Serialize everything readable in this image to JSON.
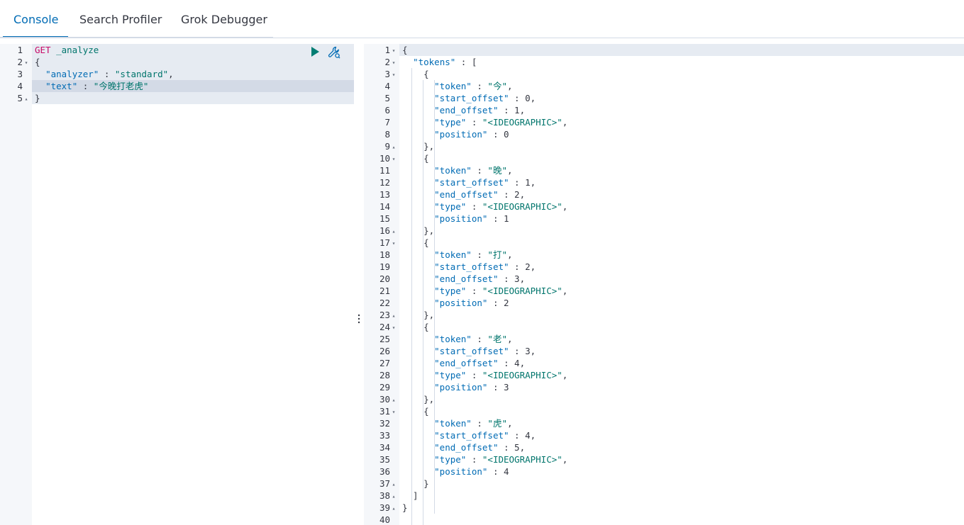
{
  "tabs": [
    {
      "label": "Console",
      "active": true
    },
    {
      "label": "Search Profiler",
      "active": false
    },
    {
      "label": "Grok Debugger",
      "active": false
    }
  ],
  "request": {
    "lines": [
      {
        "num": "1",
        "fold": "",
        "parts": [
          {
            "t": "GET",
            "c": "kw-method"
          },
          {
            "t": " ",
            "c": "punc"
          },
          {
            "t": "_analyze",
            "c": "kw-url"
          }
        ]
      },
      {
        "num": "2",
        "fold": "▾",
        "parts": [
          {
            "t": "{",
            "c": "punc"
          }
        ]
      },
      {
        "num": "3",
        "fold": "",
        "parts": [
          {
            "t": "  ",
            "c": "punc"
          },
          {
            "t": "\"analyzer\"",
            "c": "key"
          },
          {
            "t": " : ",
            "c": "punc"
          },
          {
            "t": "\"standard\"",
            "c": "str"
          },
          {
            "t": ",",
            "c": "punc"
          }
        ]
      },
      {
        "num": "4",
        "fold": "",
        "parts": [
          {
            "t": "  ",
            "c": "punc"
          },
          {
            "t": "\"text\"",
            "c": "key"
          },
          {
            "t": " : ",
            "c": "punc"
          },
          {
            "t": "\"今晚打老虎\"",
            "c": "str"
          }
        ]
      },
      {
        "num": "5",
        "fold": "▴",
        "parts": [
          {
            "t": "}",
            "c": "punc"
          }
        ]
      }
    ]
  },
  "response": {
    "lines": [
      {
        "num": "1",
        "fold": "▾",
        "parts": [
          {
            "t": "{",
            "c": "punc"
          }
        ]
      },
      {
        "num": "2",
        "fold": "▾",
        "parts": [
          {
            "t": "  ",
            "c": "punc"
          },
          {
            "t": "\"tokens\"",
            "c": "key"
          },
          {
            "t": " : [",
            "c": "punc"
          }
        ]
      },
      {
        "num": "3",
        "fold": "▾",
        "parts": [
          {
            "t": "    {",
            "c": "punc"
          }
        ]
      },
      {
        "num": "4",
        "fold": "",
        "parts": [
          {
            "t": "      ",
            "c": "punc"
          },
          {
            "t": "\"token\"",
            "c": "key"
          },
          {
            "t": " : ",
            "c": "punc"
          },
          {
            "t": "\"今\"",
            "c": "str"
          },
          {
            "t": ",",
            "c": "punc"
          }
        ]
      },
      {
        "num": "5",
        "fold": "",
        "parts": [
          {
            "t": "      ",
            "c": "punc"
          },
          {
            "t": "\"start_offset\"",
            "c": "key"
          },
          {
            "t": " : 0,",
            "c": "num"
          }
        ]
      },
      {
        "num": "6",
        "fold": "",
        "parts": [
          {
            "t": "      ",
            "c": "punc"
          },
          {
            "t": "\"end_offset\"",
            "c": "key"
          },
          {
            "t": " : 1,",
            "c": "num"
          }
        ]
      },
      {
        "num": "7",
        "fold": "",
        "parts": [
          {
            "t": "      ",
            "c": "punc"
          },
          {
            "t": "\"type\"",
            "c": "key"
          },
          {
            "t": " : ",
            "c": "punc"
          },
          {
            "t": "\"<IDEOGRAPHIC>\"",
            "c": "str"
          },
          {
            "t": ",",
            "c": "punc"
          }
        ]
      },
      {
        "num": "8",
        "fold": "",
        "parts": [
          {
            "t": "      ",
            "c": "punc"
          },
          {
            "t": "\"position\"",
            "c": "key"
          },
          {
            "t": " : 0",
            "c": "num"
          }
        ]
      },
      {
        "num": "9",
        "fold": "▴",
        "parts": [
          {
            "t": "    },",
            "c": "punc"
          }
        ]
      },
      {
        "num": "10",
        "fold": "▾",
        "parts": [
          {
            "t": "    {",
            "c": "punc"
          }
        ]
      },
      {
        "num": "11",
        "fold": "",
        "parts": [
          {
            "t": "      ",
            "c": "punc"
          },
          {
            "t": "\"token\"",
            "c": "key"
          },
          {
            "t": " : ",
            "c": "punc"
          },
          {
            "t": "\"晚\"",
            "c": "str"
          },
          {
            "t": ",",
            "c": "punc"
          }
        ]
      },
      {
        "num": "12",
        "fold": "",
        "parts": [
          {
            "t": "      ",
            "c": "punc"
          },
          {
            "t": "\"start_offset\"",
            "c": "key"
          },
          {
            "t": " : 1,",
            "c": "num"
          }
        ]
      },
      {
        "num": "13",
        "fold": "",
        "parts": [
          {
            "t": "      ",
            "c": "punc"
          },
          {
            "t": "\"end_offset\"",
            "c": "key"
          },
          {
            "t": " : 2,",
            "c": "num"
          }
        ]
      },
      {
        "num": "14",
        "fold": "",
        "parts": [
          {
            "t": "      ",
            "c": "punc"
          },
          {
            "t": "\"type\"",
            "c": "key"
          },
          {
            "t": " : ",
            "c": "punc"
          },
          {
            "t": "\"<IDEOGRAPHIC>\"",
            "c": "str"
          },
          {
            "t": ",",
            "c": "punc"
          }
        ]
      },
      {
        "num": "15",
        "fold": "",
        "parts": [
          {
            "t": "      ",
            "c": "punc"
          },
          {
            "t": "\"position\"",
            "c": "key"
          },
          {
            "t": " : 1",
            "c": "num"
          }
        ]
      },
      {
        "num": "16",
        "fold": "▴",
        "parts": [
          {
            "t": "    },",
            "c": "punc"
          }
        ]
      },
      {
        "num": "17",
        "fold": "▾",
        "parts": [
          {
            "t": "    {",
            "c": "punc"
          }
        ]
      },
      {
        "num": "18",
        "fold": "",
        "parts": [
          {
            "t": "      ",
            "c": "punc"
          },
          {
            "t": "\"token\"",
            "c": "key"
          },
          {
            "t": " : ",
            "c": "punc"
          },
          {
            "t": "\"打\"",
            "c": "str"
          },
          {
            "t": ",",
            "c": "punc"
          }
        ]
      },
      {
        "num": "19",
        "fold": "",
        "parts": [
          {
            "t": "      ",
            "c": "punc"
          },
          {
            "t": "\"start_offset\"",
            "c": "key"
          },
          {
            "t": " : 2,",
            "c": "num"
          }
        ]
      },
      {
        "num": "20",
        "fold": "",
        "parts": [
          {
            "t": "      ",
            "c": "punc"
          },
          {
            "t": "\"end_offset\"",
            "c": "key"
          },
          {
            "t": " : 3,",
            "c": "num"
          }
        ]
      },
      {
        "num": "21",
        "fold": "",
        "parts": [
          {
            "t": "      ",
            "c": "punc"
          },
          {
            "t": "\"type\"",
            "c": "key"
          },
          {
            "t": " : ",
            "c": "punc"
          },
          {
            "t": "\"<IDEOGRAPHIC>\"",
            "c": "str"
          },
          {
            "t": ",",
            "c": "punc"
          }
        ]
      },
      {
        "num": "22",
        "fold": "",
        "parts": [
          {
            "t": "      ",
            "c": "punc"
          },
          {
            "t": "\"position\"",
            "c": "key"
          },
          {
            "t": " : 2",
            "c": "num"
          }
        ]
      },
      {
        "num": "23",
        "fold": "▴",
        "parts": [
          {
            "t": "    },",
            "c": "punc"
          }
        ]
      },
      {
        "num": "24",
        "fold": "▾",
        "parts": [
          {
            "t": "    {",
            "c": "punc"
          }
        ]
      },
      {
        "num": "25",
        "fold": "",
        "parts": [
          {
            "t": "      ",
            "c": "punc"
          },
          {
            "t": "\"token\"",
            "c": "key"
          },
          {
            "t": " : ",
            "c": "punc"
          },
          {
            "t": "\"老\"",
            "c": "str"
          },
          {
            "t": ",",
            "c": "punc"
          }
        ]
      },
      {
        "num": "26",
        "fold": "",
        "parts": [
          {
            "t": "      ",
            "c": "punc"
          },
          {
            "t": "\"start_offset\"",
            "c": "key"
          },
          {
            "t": " : 3,",
            "c": "num"
          }
        ]
      },
      {
        "num": "27",
        "fold": "",
        "parts": [
          {
            "t": "      ",
            "c": "punc"
          },
          {
            "t": "\"end_offset\"",
            "c": "key"
          },
          {
            "t": " : 4,",
            "c": "num"
          }
        ]
      },
      {
        "num": "28",
        "fold": "",
        "parts": [
          {
            "t": "      ",
            "c": "punc"
          },
          {
            "t": "\"type\"",
            "c": "key"
          },
          {
            "t": " : ",
            "c": "punc"
          },
          {
            "t": "\"<IDEOGRAPHIC>\"",
            "c": "str"
          },
          {
            "t": ",",
            "c": "punc"
          }
        ]
      },
      {
        "num": "29",
        "fold": "",
        "parts": [
          {
            "t": "      ",
            "c": "punc"
          },
          {
            "t": "\"position\"",
            "c": "key"
          },
          {
            "t": " : 3",
            "c": "num"
          }
        ]
      },
      {
        "num": "30",
        "fold": "▴",
        "parts": [
          {
            "t": "    },",
            "c": "punc"
          }
        ]
      },
      {
        "num": "31",
        "fold": "▾",
        "parts": [
          {
            "t": "    {",
            "c": "punc"
          }
        ]
      },
      {
        "num": "32",
        "fold": "",
        "parts": [
          {
            "t": "      ",
            "c": "punc"
          },
          {
            "t": "\"token\"",
            "c": "key"
          },
          {
            "t": " : ",
            "c": "punc"
          },
          {
            "t": "\"虎\"",
            "c": "str"
          },
          {
            "t": ",",
            "c": "punc"
          }
        ]
      },
      {
        "num": "33",
        "fold": "",
        "parts": [
          {
            "t": "      ",
            "c": "punc"
          },
          {
            "t": "\"start_offset\"",
            "c": "key"
          },
          {
            "t": " : 4,",
            "c": "num"
          }
        ]
      },
      {
        "num": "34",
        "fold": "",
        "parts": [
          {
            "t": "      ",
            "c": "punc"
          },
          {
            "t": "\"end_offset\"",
            "c": "key"
          },
          {
            "t": " : 5,",
            "c": "num"
          }
        ]
      },
      {
        "num": "35",
        "fold": "",
        "parts": [
          {
            "t": "      ",
            "c": "punc"
          },
          {
            "t": "\"type\"",
            "c": "key"
          },
          {
            "t": " : ",
            "c": "punc"
          },
          {
            "t": "\"<IDEOGRAPHIC>\"",
            "c": "str"
          },
          {
            "t": ",",
            "c": "punc"
          }
        ]
      },
      {
        "num": "36",
        "fold": "",
        "parts": [
          {
            "t": "      ",
            "c": "punc"
          },
          {
            "t": "\"position\"",
            "c": "key"
          },
          {
            "t": " : 4",
            "c": "num"
          }
        ]
      },
      {
        "num": "37",
        "fold": "▴",
        "parts": [
          {
            "t": "    }",
            "c": "punc"
          }
        ]
      },
      {
        "num": "38",
        "fold": "▴",
        "parts": [
          {
            "t": "  ]",
            "c": "punc"
          }
        ]
      },
      {
        "num": "39",
        "fold": "▴",
        "parts": [
          {
            "t": "}",
            "c": "punc"
          }
        ]
      },
      {
        "num": "40",
        "fold": "",
        "parts": [
          {
            "t": "",
            "c": "punc"
          }
        ]
      }
    ]
  },
  "icons": {
    "run": "play-icon",
    "settings": "wrench-icon",
    "resize": "vertical-dots-icon"
  },
  "colors": {
    "accent": "#006bb4",
    "run_green": "#017d73",
    "method": "#c80a68",
    "string": "#00756c"
  }
}
